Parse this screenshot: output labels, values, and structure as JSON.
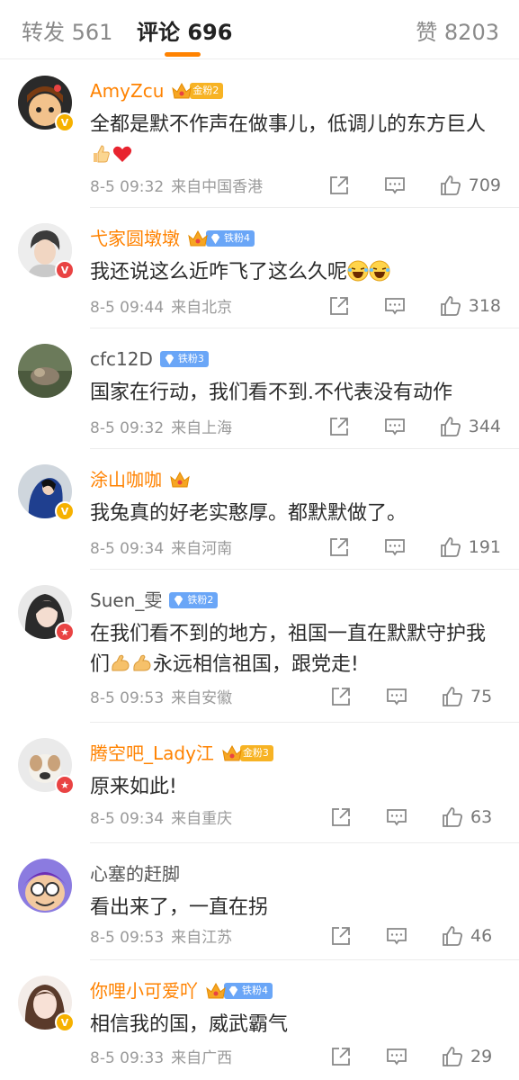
{
  "tabs": {
    "repost": "转发 561",
    "comment": "评论 696",
    "like": "赞 8203"
  },
  "comments": [
    {
      "user": "AmyZcu",
      "badge_text": "金粉2",
      "badge_type": "gold",
      "verified": "gold",
      "text": "全都是默不作声在做事儿，低调儿的东方巨人",
      "emojis": [
        "thumbs-up-icon",
        "red-heart-icon"
      ],
      "time": "8-5 09:32",
      "location": "来自中国香港",
      "likes": "709"
    },
    {
      "user": "弋家圆墩墩",
      "badge_text": "铁粉4",
      "badge_type": "blue-crown",
      "verified": "red",
      "text": "我还说这么近咋飞了这么久呢",
      "emojis": [
        "laughing-emoji-icon",
        "laughing-emoji-icon"
      ],
      "time": "8-5 09:44",
      "location": "来自北京",
      "likes": "318"
    },
    {
      "user": "cfc12D",
      "badge_text": "铁粉3",
      "badge_type": "blue",
      "verified": "",
      "text": "国家在行动，我们看不到.不代表没有动作",
      "emojis": [],
      "time": "8-5 09:32",
      "location": "来自上海",
      "likes": "344"
    },
    {
      "user": "涂山咖咖",
      "badge_text": "",
      "badge_type": "crown-only",
      "verified": "gold",
      "text": "我兔真的好老实憨厚。都默默做了。",
      "emojis": [],
      "time": "8-5 09:34",
      "location": "来自河南",
      "likes": "191"
    },
    {
      "user": "Suen_雯",
      "badge_text": "铁粉2",
      "badge_type": "blue",
      "verified": "red",
      "text": "在我们看不到的地方，祖国一直在默默守护我们",
      "text2": "永远相信祖国，跟党走!",
      "emojis": [
        "flexed-biceps-icon",
        "flexed-biceps-icon"
      ],
      "time": "8-5 09:53",
      "location": "来自安徽",
      "likes": "75"
    },
    {
      "user": "腾空吧_Lady江",
      "badge_text": "金粉3",
      "badge_type": "gold",
      "verified": "red",
      "text": "原来如此!",
      "emojis": [],
      "time": "8-5 09:34",
      "location": "来自重庆",
      "likes": "63"
    },
    {
      "user": "心塞的赶脚",
      "badge_text": "",
      "badge_type": "none",
      "verified": "",
      "text": "看出来了，一直在拐",
      "emojis": [],
      "time": "8-5 09:53",
      "location": "来自江苏",
      "likes": "46"
    },
    {
      "user": "你哩小可爱吖",
      "badge_text": "铁粉4",
      "badge_type": "blue-crown",
      "verified": "gold",
      "text": "相信我的国，威武霸气",
      "emojis": [],
      "time": "8-5 09:33",
      "location": "来自广西",
      "likes": "29"
    }
  ],
  "colors": {
    "accent": "#ff8200",
    "gold_badge": "#f7b324",
    "blue_badge": "#6aa6f7"
  }
}
